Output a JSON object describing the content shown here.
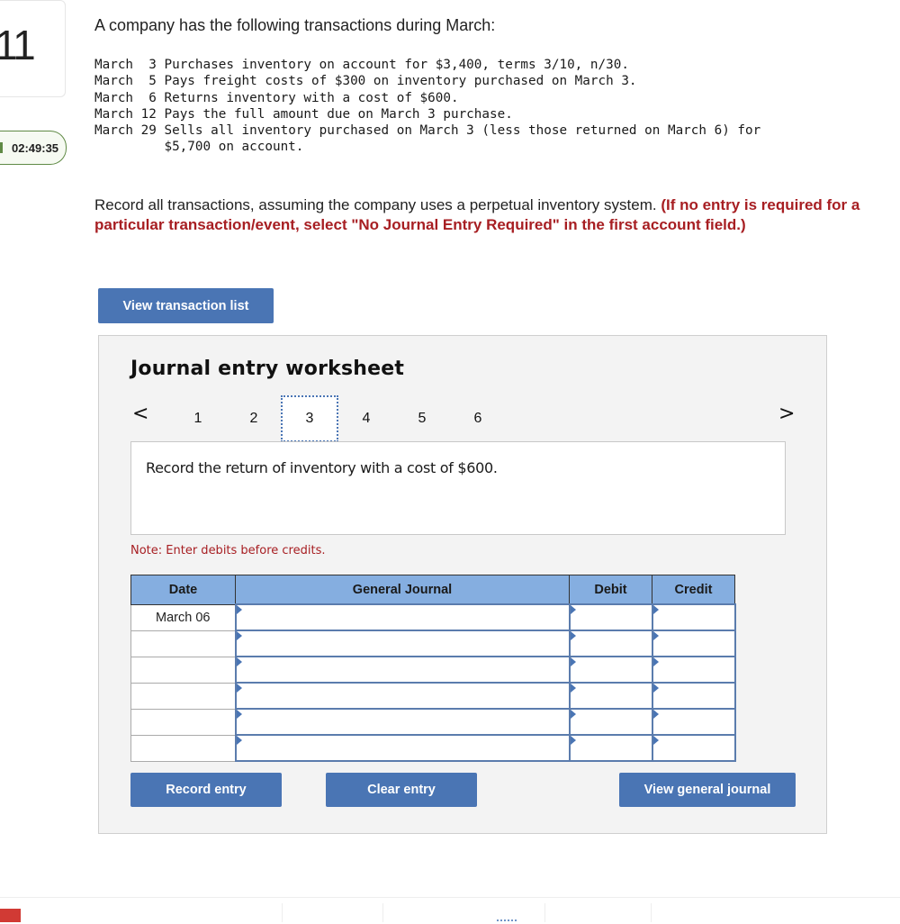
{
  "question": {
    "number": "11",
    "timer": "02:49:35",
    "intro": "A company has the following transactions during March:",
    "transactions": [
      {
        "date": "March  3",
        "text": "Purchases inventory on account for $3,400, terms 3/10, n/30."
      },
      {
        "date": "March  5",
        "text": "Pays freight costs of $300 on inventory purchased on March 3."
      },
      {
        "date": "March  6",
        "text": "Returns inventory with a cost of $600."
      },
      {
        "date": "March 12",
        "text": "Pays the full amount due on March 3 purchase."
      },
      {
        "date": "March 29",
        "text": "Sells all inventory purchased on March 3 (less those returned on March 6) for\n         $5,700 on account."
      }
    ],
    "instruction_plain": "Record all transactions, assuming the company uses a perpetual inventory system. ",
    "instruction_bold": "(If no entry is required for a particular transaction/event, select \"No Journal Entry Required\" in the first account field.)"
  },
  "buttons": {
    "view_transaction_list": "View transaction list",
    "record_entry": "Record entry",
    "clear_entry": "Clear entry",
    "view_general_journal": "View general journal"
  },
  "worksheet": {
    "title": "Journal entry worksheet",
    "nav_prev": "<",
    "nav_next": ">",
    "tabs": [
      "1",
      "2",
      "3",
      "4",
      "5",
      "6"
    ],
    "active_tab": 3,
    "prompt": "Record the return of inventory with a cost of $600.",
    "note": "Note: Enter debits before credits.",
    "columns": [
      "Date",
      "General Journal",
      "Debit",
      "Credit"
    ],
    "rows": [
      {
        "date": "March 06",
        "account": "",
        "debit": "",
        "credit": ""
      },
      {
        "date": "",
        "account": "",
        "debit": "",
        "credit": ""
      },
      {
        "date": "",
        "account": "",
        "debit": "",
        "credit": ""
      },
      {
        "date": "",
        "account": "",
        "debit": "",
        "credit": ""
      },
      {
        "date": "",
        "account": "",
        "debit": "",
        "credit": ""
      },
      {
        "date": "",
        "account": "",
        "debit": "",
        "credit": ""
      }
    ]
  },
  "colors": {
    "accent_button": "#4a75b4",
    "header_fill": "#85aee0",
    "emphasis_red": "#a71e22",
    "timer_green": "#5f8a45"
  }
}
